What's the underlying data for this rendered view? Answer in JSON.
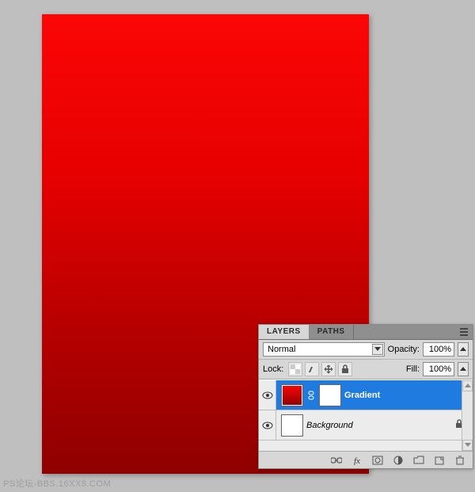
{
  "watermark": "PS论坛-BBS.16XX8.COM",
  "panel": {
    "tabs": {
      "layers": "LAYERS",
      "paths": "PATHS"
    },
    "blend_mode": "Normal",
    "opacity_label": "Opacity:",
    "opacity_value": "100%",
    "lock_label": "Lock:",
    "fill_label": "Fill:",
    "fill_value": "100%",
    "layers": [
      {
        "name": "Gradient",
        "selected": true,
        "has_mask": true,
        "visible": true
      },
      {
        "name": "Background",
        "selected": false,
        "locked": true,
        "visible": true,
        "is_bg": true
      }
    ]
  }
}
